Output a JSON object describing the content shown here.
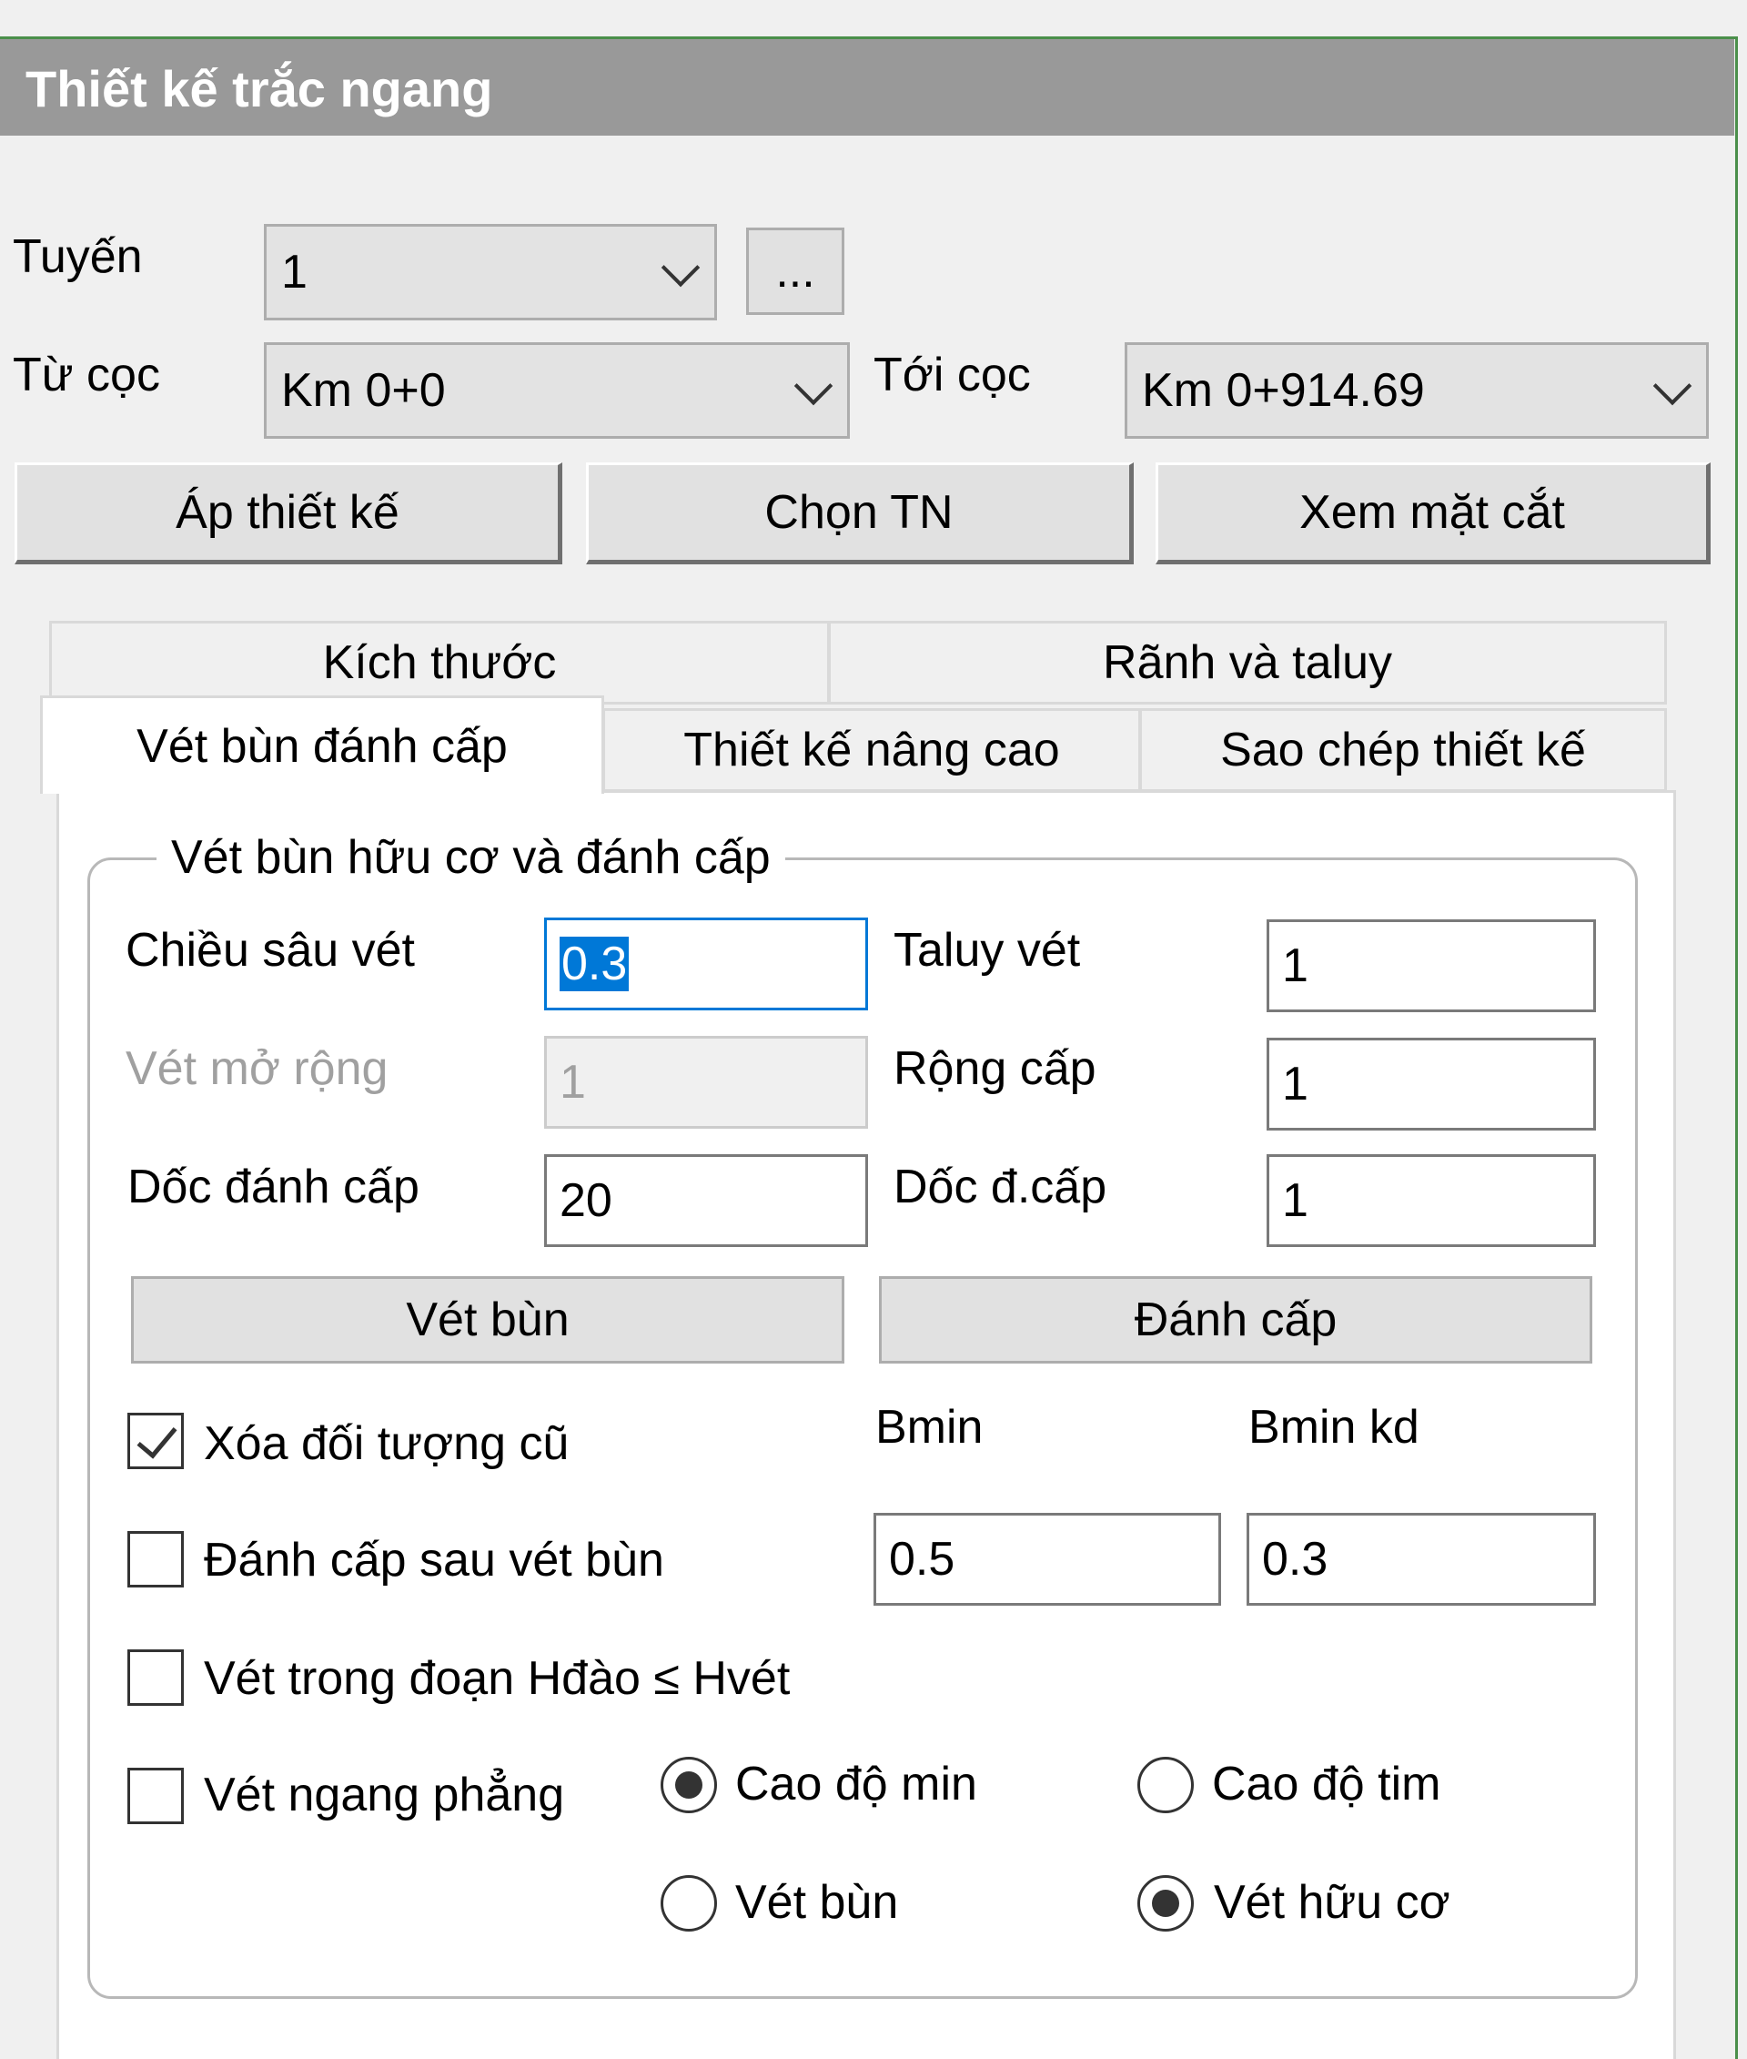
{
  "window": {
    "title": "Thiết kế trắc ngang"
  },
  "route": {
    "label": "Tuyến",
    "value": "1",
    "more_button": "..."
  },
  "stations": {
    "from_label": "Từ cọc",
    "from_value": "Km 0+0",
    "to_label": "Tới cọc",
    "to_value": "Km 0+914.69"
  },
  "actions": {
    "apply_design": "Áp thiết kế",
    "select_tn": "Chọn TN",
    "view_section": "Xem mặt cắt"
  },
  "tabs": [
    {
      "label": "Kích thước"
    },
    {
      "label": "Rãnh và taluy"
    },
    {
      "label": "Vét bùn đánh cấp"
    },
    {
      "label": "Thiết kế nâng cao"
    },
    {
      "label": "Sao chép thiết kế"
    }
  ],
  "group": {
    "title": "Vét bùn hữu cơ và đánh cấp",
    "depth_label": "Chiều sâu vét",
    "depth_value": "0.3",
    "taluy_label": "Taluy vét",
    "taluy_value": "1",
    "expand_label": "Vét mở rộng",
    "expand_value": "1",
    "step_width_label": "Rộng cấp",
    "step_width_value": "1",
    "step_slope_label": "Dốc đánh cấp",
    "step_slope_value": "20",
    "step_slope2_label": "Dốc đ.cấp",
    "step_slope2_value": "1",
    "mud_button": "Vét bùn",
    "step_button": "Đánh cấp",
    "delete_old_label": "Xóa đối tượng cũ",
    "delete_old_checked": true,
    "bmin_label": "Bmin",
    "bmin_kd_label": "Bmin kd",
    "step_after_label": "Đánh cấp sau vét bùn",
    "step_after_checked": false,
    "bmin_value": "0.5",
    "bmin_kd_value": "0.3",
    "within_label": "Vét trong đoạn Hđào ≤ Hvét",
    "within_checked": false,
    "flat_label": "Vét ngang phẳng",
    "flat_checked": false,
    "radio_elev_min": "Cao độ min",
    "radio_elev_center": "Cao độ tim",
    "elev_selected": "Cao độ min",
    "radio_mud": "Vét bùn",
    "radio_organic": "Vét hữu cơ",
    "type_selected": "Vét hữu cơ"
  }
}
